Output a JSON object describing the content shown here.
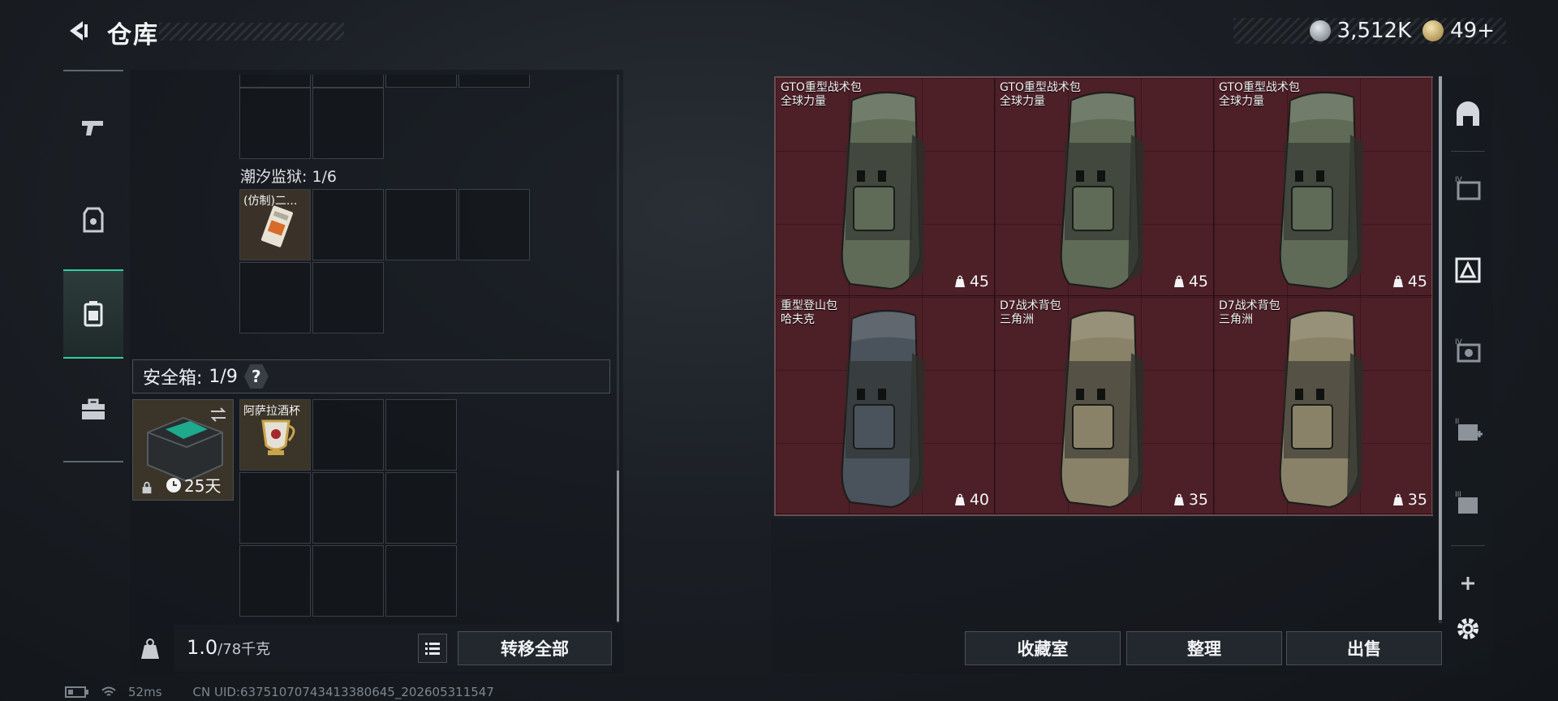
{
  "header": {
    "title": "仓库",
    "currency_silver": "3,512K",
    "currency_gold": "49+"
  },
  "left_panel": {
    "container_label": "潮汐监狱: 1/6",
    "item_forged": "(仿制)二...",
    "safebox_label": "安全箱:",
    "safebox_count": "1/9",
    "safebox_help": "?",
    "safebox_days": "25天",
    "item_cup": "阿萨拉酒杯"
  },
  "weight": {
    "current": "1.0",
    "max": "/78千克"
  },
  "buttons": {
    "transfer_all": "转移全部",
    "collection": "收藏室",
    "organize": "整理",
    "sell": "出售"
  },
  "storage_items": [
    {
      "name": "GTO重型战术包",
      "faction": "全球力量",
      "capacity": "45",
      "color": "#5f6a57"
    },
    {
      "name": "GTO重型战术包",
      "faction": "全球力量",
      "capacity": "45",
      "color": "#5f6a57"
    },
    {
      "name": "GTO重型战术包",
      "faction": "全球力量",
      "capacity": "45",
      "color": "#5f6a57"
    },
    {
      "name": "重型登山包",
      "faction": "哈夫克",
      "capacity": "40",
      "color": "#4a525c"
    },
    {
      "name": "D7战术背包",
      "faction": "三角洲",
      "capacity": "35",
      "color": "#8a8268"
    },
    {
      "name": "D7战术背包",
      "faction": "三角洲",
      "capacity": "35",
      "color": "#8a8268"
    }
  ],
  "status": {
    "ping": "52ms",
    "uid": "CN UID:637510707434133806​45_202605311547"
  },
  "colors": {
    "accent": "#2fd0a0",
    "storage_bg": "#4d1f27"
  }
}
